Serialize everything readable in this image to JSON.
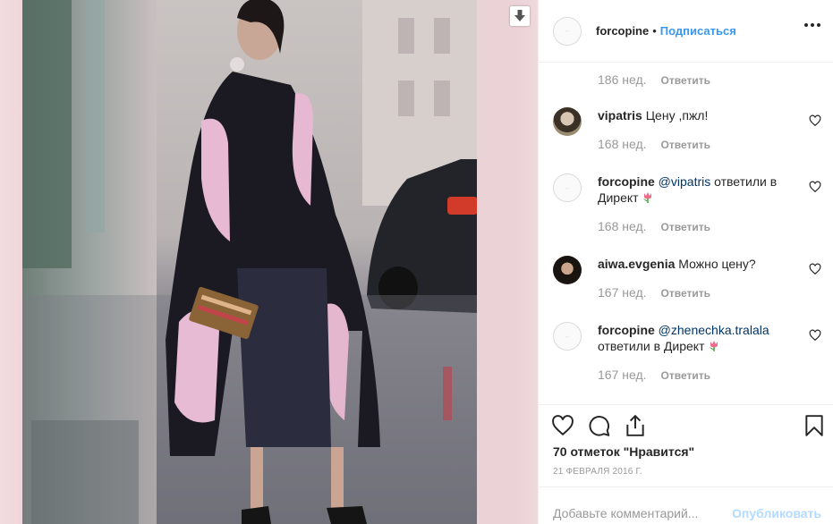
{
  "post": {
    "image_alt": "Fashion street photo",
    "download_icon": "download-arrow-icon"
  },
  "header": {
    "username": "forcopine",
    "dot": "•",
    "follow_label": "Подписаться",
    "more_icon": "more-horizontal-icon"
  },
  "comments": {
    "top_meta": {
      "time": "186 нед.",
      "reply": "Ответить"
    },
    "items": [
      {
        "user": "vipatris",
        "text": "Цену ,пжл!",
        "mention": "",
        "time": "168 нед.",
        "reply": "Ответить",
        "avatar": "photo"
      },
      {
        "user": "forcopine",
        "mention": "@vipatris",
        "text": "ответили в Директ",
        "emoji": "tulip",
        "time": "168 нед.",
        "reply": "Ответить",
        "avatar": "default"
      },
      {
        "user": "aiwa.evgenia",
        "text": "Можно цену?",
        "mention": "",
        "time": "167 нед.",
        "reply": "Ответить",
        "avatar": "photo"
      },
      {
        "user": "forcopine",
        "mention": "@zhenechka.tralala",
        "text": "ответили в Директ",
        "emoji": "tulip",
        "time": "167 нед.",
        "reply": "Ответить",
        "avatar": "default"
      }
    ]
  },
  "actions": {
    "like_icon": "heart-icon",
    "comment_icon": "comment-bubble-icon",
    "share_icon": "share-icon",
    "save_icon": "bookmark-icon",
    "likes_text": "70 отметок \"Нравится\"",
    "date": "21 ФЕВРАЛЯ 2016 Г."
  },
  "add_comment": {
    "placeholder": "Добавьте комментарий...",
    "publish_label": "Опубликовать"
  },
  "colors": {
    "accent": "#3897f0",
    "mention": "#003569",
    "muted": "#999999",
    "publish_disabled": "#b3dbff"
  }
}
